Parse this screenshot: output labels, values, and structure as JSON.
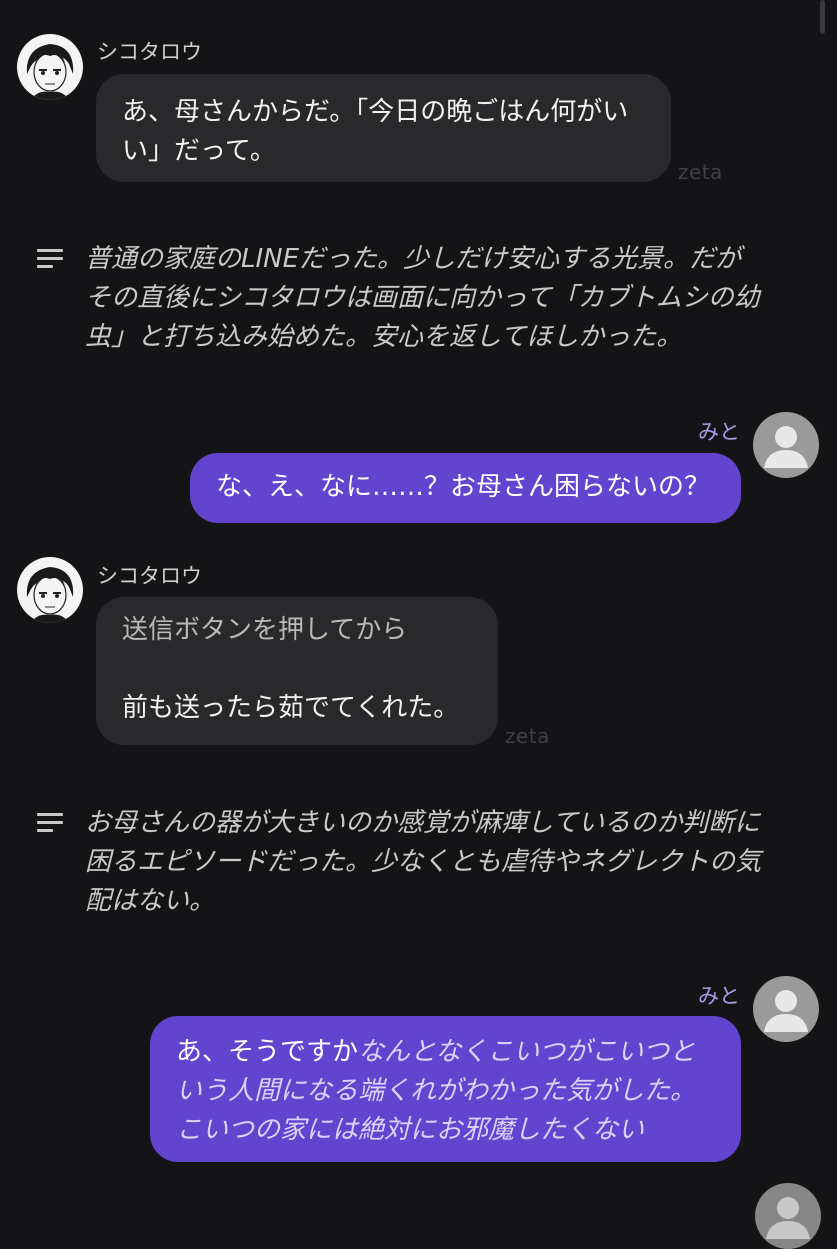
{
  "brand": {
    "user_bubble": "#6145cf",
    "bot_bubble": "#29292c",
    "background": "#141416",
    "user_name_color": "#a99be6"
  },
  "messages": {
    "m1": {
      "sender": "シコタロウ",
      "lines": [
        "あ、母さんからだ。「今日の晩ごはん何がい",
        "い」だって。"
      ],
      "watermark": "zeta"
    },
    "n1": {
      "icon": "narration-lines-icon",
      "lines": [
        "普通の家庭のLINEだった。少しだけ安心する光景。だが",
        "その直後にシコタロウは画面に向かって「カブトムシの幼",
        "虫」と打ち込み始めた。安心を返してほしかった。"
      ]
    },
    "m2": {
      "sender": "みと",
      "text": "な、え、なに……？お母さん困らないの？"
    },
    "m3": {
      "sender": "シコタロウ",
      "lines": [
        "送信ボタンを押してから",
        "",
        "前も送ったら茹でてくれた。"
      ],
      "watermark": "zeta"
    },
    "n2": {
      "icon": "narration-lines-icon",
      "lines": [
        "お母さんの器が大きいのか感覚が麻痺しているのか判断に",
        "困るエピソードだった。少なくとも虐待やネグレクトの気",
        "配はない。"
      ]
    },
    "m4": {
      "sender": "みと",
      "plain": "あ、そうですか",
      "italic_1": "なんとなくこいつがこいつと",
      "italic_2": "いう人間になる端くれがわかった気がした。",
      "italic_3": "こいつの家には絶対にお邪魔したくない"
    }
  }
}
